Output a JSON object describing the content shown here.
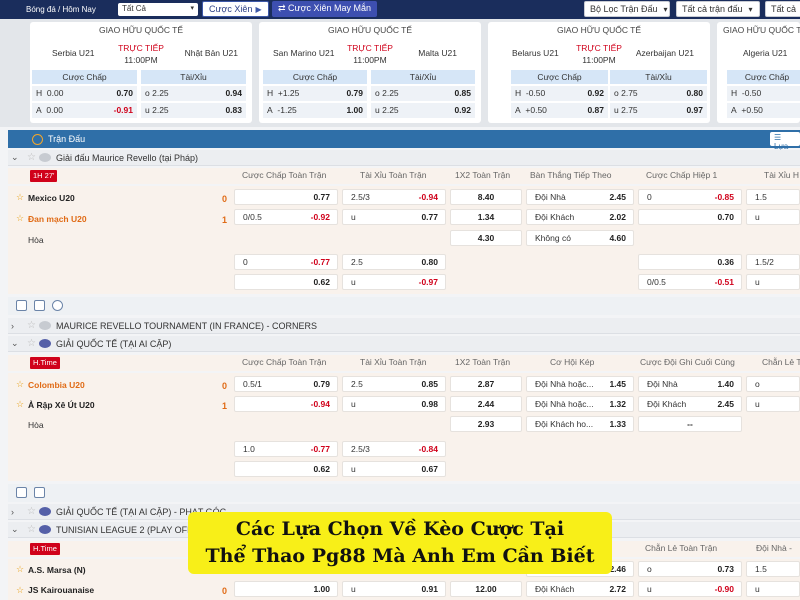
{
  "topbar": {
    "breadcrumb": "Bóng đá / Hôm Nay",
    "day_select": "Tất Cả",
    "parlay_label": "Cược Xiên",
    "random_parlay_label": "Cược Xiên May Mắn",
    "filter_label": "Bộ Lọc Trận Đấu",
    "all_leagues_label": "Tất cả trận đấu",
    "leagues_label": "Tất cả"
  },
  "banner_cards": [
    {
      "competition": "GIAO HỮU QUỐC TẾ",
      "home": "Serbia U21",
      "away": "Nhật Bản U21",
      "status": "TRỰC TIẾP",
      "time": "11:00PM",
      "hdr_handicap": "Cược Chấp",
      "hdr_ou": "Tài/Xỉu",
      "rows": [
        {
          "hl": "H",
          "hv": "0.00",
          "ho": "0.70",
          "ol": "o",
          "ov": "2.25",
          "oo": "0.94"
        },
        {
          "hl": "A",
          "hv": "0.00",
          "ho": "-0.91",
          "ol": "u",
          "ov": "2.25",
          "oo": "0.83"
        }
      ]
    },
    {
      "competition": "GIAO HỮU QUỐC TẾ",
      "home": "San Marino U21",
      "away": "Malta U21",
      "status": "TRỰC TIẾP",
      "time": "11:00PM",
      "hdr_handicap": "Cược Chấp",
      "hdr_ou": "Tài/Xỉu",
      "rows": [
        {
          "hl": "H",
          "hv": "+1.25",
          "ho": "0.79",
          "ol": "o",
          "ov": "2.25",
          "oo": "0.85"
        },
        {
          "hl": "A",
          "hv": "-1.25",
          "ho": "1.00",
          "ol": "u",
          "ov": "2.25",
          "oo": "0.92"
        }
      ]
    },
    {
      "competition": "GIAO HỮU QUỐC TẾ",
      "home": "Belarus U21",
      "away": "Azerbaijan U21",
      "status": "TRỰC TIẾP",
      "time": "11:00PM",
      "hdr_handicap": "Cược Chấp",
      "hdr_ou": "Tài/Xỉu",
      "rows": [
        {
          "hl": "H",
          "hv": "-0.50",
          "ho": "0.92",
          "ol": "o",
          "ov": "2.75",
          "oo": "0.80"
        },
        {
          "hl": "A",
          "hv": "+0.50",
          "ho": "0.87",
          "ol": "u",
          "ov": "2.75",
          "oo": "0.97"
        }
      ]
    },
    {
      "competition": "GIAO HỮU QUỐC TẾ",
      "home": "Algeria U21",
      "away": "",
      "status": "",
      "time": "",
      "hdr_handicap": "Cược Chấp",
      "hdr_ou": "",
      "rows": [
        {
          "hl": "H",
          "hv": "-0.50",
          "ho": "",
          "ol": "",
          "ov": "",
          "oo": ""
        },
        {
          "hl": "A",
          "hv": "+0.50",
          "ho": "",
          "ol": "",
          "ov": "",
          "oo": ""
        }
      ]
    }
  ],
  "section": {
    "title": "Trận Đấu",
    "filter_btn": "Lựa"
  },
  "league1": {
    "name": "Giải đấu Maurice Revello (tại Pháp)"
  },
  "match1": {
    "badge": "1H 27'",
    "cols": [
      "Cược Chấp Toàn Trận",
      "Tài Xỉu Toàn Trận",
      "1X2 Toàn Trận",
      "Bàn Thắng Tiếp Theo",
      "Cược Chấp Hiệp 1",
      "Tài Xỉu H"
    ],
    "home": "Mexico U20",
    "away": "Đan mạch U20",
    "draw": "Hòa",
    "home_score": "0",
    "away_score": "1",
    "ah": [
      {
        "l": "",
        "v": "0.77"
      },
      {
        "l": "0/0.5",
        "v": "-0.92"
      },
      {
        "l": "0",
        "v": "-0.77"
      },
      {
        "l": "",
        "v": "0.62"
      }
    ],
    "ou": [
      {
        "l": "2.5/3",
        "v": "-0.94"
      },
      {
        "l": "u",
        "v": "0.77"
      },
      {
        "l": "2.5",
        "v": "0.80"
      },
      {
        "l": "u",
        "v": "-0.97"
      }
    ],
    "x12": [
      "8.40",
      "1.34",
      "4.30"
    ],
    "next_goal": [
      {
        "l": "Đội Nhà",
        "v": "2.45"
      },
      {
        "l": "Đội Khách",
        "v": "2.02"
      },
      {
        "l": "Không có",
        "v": "4.60"
      }
    ],
    "h1ah": [
      {
        "l": "0",
        "v": "-0.85"
      },
      {
        "l": "",
        "v": "0.70"
      },
      {
        "l": "",
        "v": "0.36"
      },
      {
        "l": "0/0.5",
        "v": "-0.51"
      }
    ],
    "h1ou": [
      {
        "l": "1.5"
      },
      {
        "l": "u"
      },
      {
        "l": "1.5/2"
      },
      {
        "l": "u"
      }
    ]
  },
  "league2": {
    "name": "MAURICE REVELLO TOURNAMENT (IN FRANCE) - CORNERS"
  },
  "league3": {
    "name": "GIẢI QUỐC TẾ (TẠI AI CẬP)"
  },
  "match2": {
    "badge": "H.Time",
    "cols": [
      "Cược Chấp Toàn Trận",
      "Tài Xỉu Toàn Trận",
      "1X2 Toàn Trận",
      "Cơ Hội Kép",
      "Cược Đội Ghi Cuối Cùng",
      "Chẵn Lẻ Toàn"
    ],
    "home": "Colombia U20",
    "away": "Ả Rập Xê Út U20",
    "draw": "Hòa",
    "home_score": "0",
    "away_score": "1",
    "ah": [
      {
        "l": "0.5/1",
        "v": "0.79"
      },
      {
        "l": "",
        "v": "-0.94"
      },
      {
        "l": "1.0",
        "v": "-0.77"
      },
      {
        "l": "",
        "v": "0.62"
      }
    ],
    "ou": [
      {
        "l": "2.5",
        "v": "0.85"
      },
      {
        "l": "u",
        "v": "0.98"
      },
      {
        "l": "2.5/3",
        "v": "-0.84"
      },
      {
        "l": "u",
        "v": "0.67"
      }
    ],
    "x12": [
      "2.87",
      "2.44",
      "2.93"
    ],
    "dc": [
      {
        "l": "Đội Nhà hoặc...",
        "v": "1.45"
      },
      {
        "l": "Đội Nhà hoặc...",
        "v": "1.32"
      },
      {
        "l": "Đội Khách ho...",
        "v": "1.33"
      }
    ],
    "last": [
      {
        "l": "Đội Nhà",
        "v": "1.40"
      },
      {
        "l": "Đội Khách",
        "v": "2.45"
      },
      {
        "l": "",
        "v": "--"
      }
    ],
    "oe": [
      {
        "l": "o"
      },
      {
        "l": "u"
      }
    ]
  },
  "league4": {
    "name": "GIẢI QUỐC TẾ (TẠI AI CẬP) - PHẠT GÓC"
  },
  "league5": {
    "name": "TUNISIAN LEAGUE 2 (PLAY OFF)"
  },
  "match3": {
    "badge": "H.Time",
    "cols": [
      "Chẵn Lẻ Toàn Trận",
      "Đội Nhà -"
    ],
    "home": "A.S. Marsa (N)",
    "away": "JS Kairouanaise",
    "home_score": "0",
    "away_score": "0",
    "ah2": "1.00",
    "ou2": "0.91",
    "x12b": "12.00",
    "ng": {
      "l": "Đội Khách",
      "v": "2.72"
    },
    "ng_top": "2.46",
    "oe": [
      {
        "l": "o",
        "v": "0.73"
      },
      {
        "l": "u",
        "v": "-0.90"
      }
    ],
    "hm": [
      "1.5",
      "u"
    ]
  },
  "banner": {
    "line1": "Các Lựa Chọn Về Kèo Cược Tại",
    "line2": "Thể Thao Pg88 Mà Anh Em Cần Biết"
  }
}
